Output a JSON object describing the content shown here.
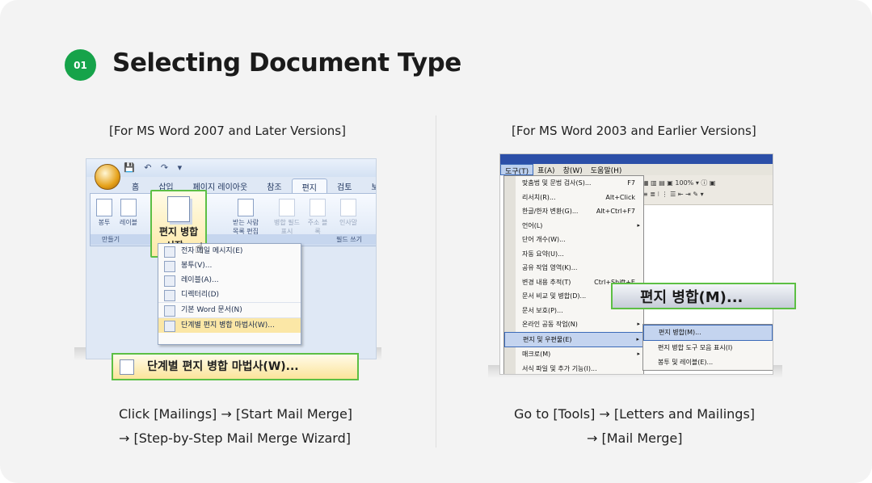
{
  "step": {
    "number": "01",
    "title": "Selecting Document Type"
  },
  "left": {
    "label": "[For MS Word 2007 and Later Versions]",
    "caption_line1": "Click [Mailings] → [Start Mail Merge]",
    "caption_line2": "→ [Step-by-Step Mail Merge Wizard]",
    "ribbon_tabs": [
      "홈",
      "삽입",
      "페이지 레이아웃",
      "참조",
      "편지",
      "검토",
      "보"
    ],
    "active_tab": "편지",
    "ribbon_buttons": [
      "봉투",
      "레이블",
      "받는 사람 목록 편집",
      "병합 필드 표시",
      "주소 블록",
      "인사말"
    ],
    "groups": [
      "만들기",
      "필드 쓰기"
    ],
    "start_merge_line1": "편지 병합",
    "start_merge_line2": "시작 ▾",
    "menu_items": [
      "전자 메일 메시지(E)",
      "봉투(V)...",
      "레이블(A)...",
      "디렉터리(D)",
      "기본 Word 문서(N)",
      "단계별 편지 병합 마법사(W)..."
    ],
    "wizard_callout": "단계별 편지 병합 마법사(W)..."
  },
  "right": {
    "label": "[For MS Word 2003 and Earlier Versions]",
    "caption_line1": "Go to [Tools] → [Letters and Mailings]",
    "caption_line2": "→ [Mail Merge]",
    "menubar": [
      "도구(T)",
      "표(A)",
      "창(W)",
      "도움말(H)"
    ],
    "toolbar_zoom": "100%",
    "menu_items": [
      {
        "label": "맞춤법 및 문법 검사(S)...",
        "shortcut": "F7"
      },
      {
        "label": "리서치(R)...",
        "shortcut": "Alt+Click"
      },
      {
        "label": "한글/한자 변환(G)...",
        "shortcut": "Alt+Ctrl+F7"
      },
      {
        "label": "언어(L)",
        "shortcut": "▸"
      },
      {
        "label": "단어 개수(W)...",
        "shortcut": ""
      },
      {
        "label": "자동 요약(U)...",
        "shortcut": ""
      },
      {
        "label": "공유 작업 영역(K)...",
        "shortcut": ""
      },
      {
        "label": "변경 내용 추적(T)",
        "shortcut": "Ctrl+Shift+E"
      },
      {
        "label": "문서 비교 및 병합(D)...",
        "shortcut": ""
      },
      {
        "label": "문서 보호(P)...",
        "shortcut": ""
      },
      {
        "label": "온라인 공동 작업(N)",
        "shortcut": "▸"
      },
      {
        "label": "편지 및 우편물(E)",
        "shortcut": "▸"
      },
      {
        "label": "매크로(M)",
        "shortcut": "▸"
      },
      {
        "label": "서식 파일 및 추가 기능(I)...",
        "shortcut": ""
      }
    ],
    "submenu_items": [
      "편지 병합(M)...",
      "편지 병합 도구 모음 표시(I)",
      "봉투 및 레이블(E)..."
    ],
    "merge_callout": "편지 병합(M)..."
  }
}
